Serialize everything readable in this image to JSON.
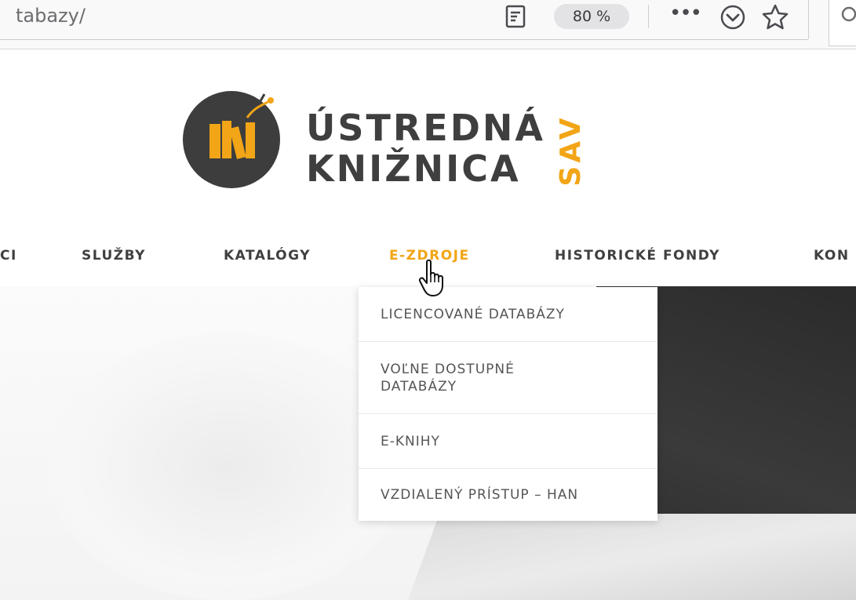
{
  "browser": {
    "url_fragment": "tabazy/",
    "zoom": "80 %",
    "menu_dots": "•••"
  },
  "site": {
    "logo_line1": "ÚSTREDNÁ",
    "logo_line2": "KNIŽNICA",
    "logo_sav": "SAV"
  },
  "nav": {
    "items": [
      {
        "label": "CI"
      },
      {
        "label": "SLUŽBY"
      },
      {
        "label": "KATALÓGY"
      },
      {
        "label": "E-ZDROJE"
      },
      {
        "label": "HISTORICKÉ FONDY"
      },
      {
        "label": "KON"
      }
    ]
  },
  "dropdown": {
    "items": [
      {
        "label": "LICENCOVANÉ DATABÁZY"
      },
      {
        "label_line1": "VOĽNE DOSTUPNÉ",
        "label_line2": "DATABÁZY"
      },
      {
        "label": "E-KNIHY"
      },
      {
        "label": "VZDIALENÝ PRÍSTUP – HAN"
      }
    ]
  },
  "colors": {
    "accent": "#f2a516",
    "text_dark": "#3f3f3f",
    "logo_circle": "#3d3d3d"
  },
  "icons": [
    "reader-view-icon",
    "pocket-icon",
    "bookmark-star-icon",
    "search-icon",
    "hand-pointer-cursor-icon"
  ]
}
